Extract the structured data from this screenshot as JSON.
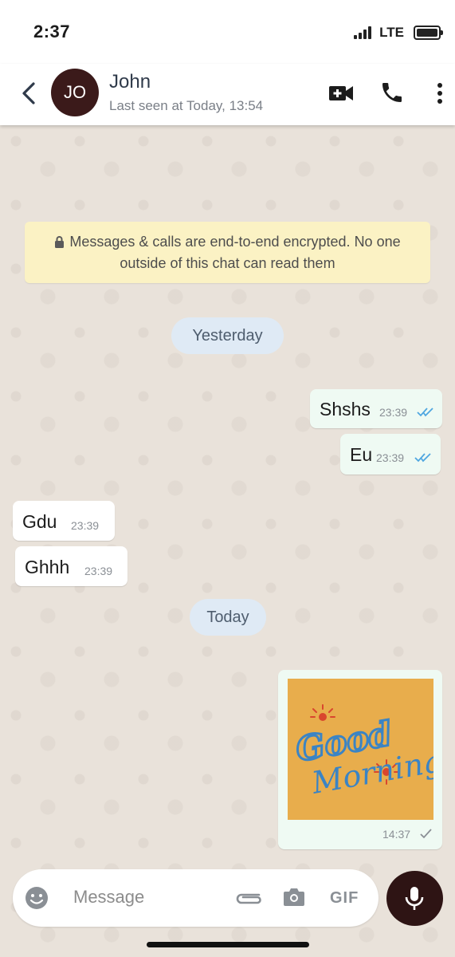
{
  "status_bar": {
    "time": "2:37",
    "network": "LTE"
  },
  "header": {
    "avatar_initials": "JO",
    "contact_name": "John",
    "last_seen": "Last seen at Today, 13:54",
    "icons": [
      "back-arrow-icon",
      "video-call-icon",
      "phone-icon",
      "more-vert-icon"
    ]
  },
  "chat": {
    "encryption_notice": "Messages & calls are end-to-end encrypted. No one outside of this chat can read them",
    "day_labels": {
      "yesterday": "Yesterday",
      "today": "Today"
    },
    "messages": [
      {
        "direction": "outgoing",
        "text": "Shshs",
        "time": "23:39",
        "status": "read"
      },
      {
        "direction": "outgoing",
        "text": "Eu",
        "time": "23:39",
        "status": "read"
      },
      {
        "direction": "incoming",
        "text": "Gdu",
        "time": "23:39"
      },
      {
        "direction": "incoming",
        "text": "Ghhh",
        "time": "23:39"
      }
    ],
    "image_message": {
      "direction": "outgoing",
      "time": "14:37",
      "status": "sent",
      "image_text": "Good Morning"
    }
  },
  "composer": {
    "placeholder": "Message",
    "gif_label": "GIF",
    "icons": [
      "emoji-icon",
      "attach-icon",
      "camera-icon",
      "gif-icon",
      "mic-icon"
    ]
  },
  "colors": {
    "accent_dark": "#3b1a1a",
    "chat_background": "#e9e2da",
    "outgoing_bubble": "#effaf3",
    "incoming_bubble": "#ffffff",
    "encryption_banner": "#fbf2c4",
    "read_ticks": "#4fa6e0"
  }
}
